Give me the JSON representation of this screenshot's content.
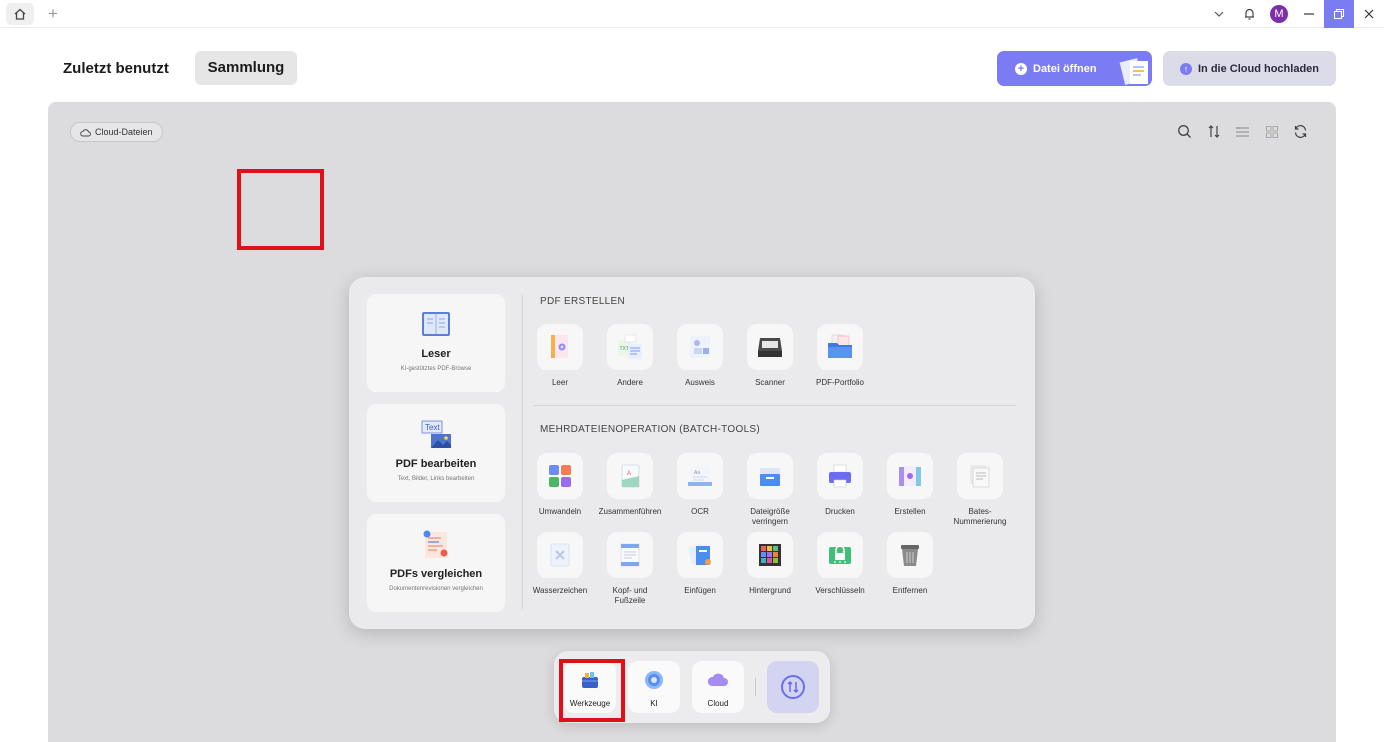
{
  "titlebar": {
    "avatar_initial": "M",
    "icons": [
      "home-icon",
      "add-tab-icon",
      "chevron-down-icon",
      "bell-icon",
      "minimize-icon",
      "restore-icon",
      "close-icon"
    ]
  },
  "header": {
    "tab_recent": "Zuletzt benutzt",
    "tab_collection": "Sammlung",
    "open_file": "Datei öffnen",
    "upload_cloud": "In die Cloud hochladen"
  },
  "workspace": {
    "cloud_files": "Cloud-Dateien"
  },
  "cards": [
    {
      "title": "Leser",
      "subtitle": "KI-gestütztes PDF-Browse"
    },
    {
      "title": "PDF bearbeiten",
      "subtitle": "Text, Bilder, Links bearbeiten",
      "icon_text": "Text"
    },
    {
      "title": "PDFs vergleichen",
      "subtitle": "Dokumentenrevisionen vergleichen"
    }
  ],
  "create": {
    "heading": "PDF ERSTELLEN",
    "tools": [
      "Leer",
      "Andere",
      "Ausweis",
      "Scanner",
      "PDF-Portfolio"
    ]
  },
  "batch": {
    "heading": "MEHRDATEIENOPERATION (BATCH-TOOLS)",
    "row1": [
      "Umwandeln",
      "Zusammenführen",
      "OCR",
      "Dateigröße verringern",
      "Drucken",
      "Erstellen",
      "Bates-Nummerierung"
    ],
    "row2": [
      "Wasserzeichen",
      "Kopf- und Fußzeile",
      "Einfügen",
      "Hintergrund",
      "Verschlüsseln",
      "Entfernen"
    ]
  },
  "dock": {
    "tools": "Werkzeuge",
    "ai": "KI",
    "cloud": "Cloud"
  },
  "colors": {
    "accent": "#7b7cf3",
    "highlight": "#e0101a",
    "workspace_bg": "#dcdcde"
  }
}
